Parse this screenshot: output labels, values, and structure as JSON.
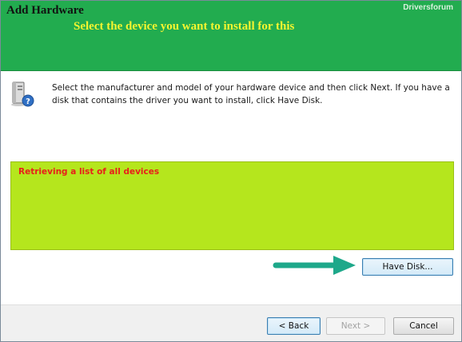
{
  "header": {
    "title": "Add Hardware",
    "subtitle": "Select the device you want to install for this",
    "watermark": "Driversforum"
  },
  "main": {
    "instructions": "Select the manufacturer and model of your hardware device and then click Next. If you have a disk that contains the driver you want to install, click Have Disk.",
    "device_list": {
      "status_text": "Retrieving a list of all devices"
    },
    "have_disk_label": "Have Disk..."
  },
  "footer": {
    "back_label": "< Back",
    "next_label": "Next >",
    "cancel_label": "Cancel"
  },
  "icons": {
    "device": "computer-tower-question-icon",
    "annotation": "arrow-right-icon"
  },
  "colors": {
    "header_bg": "#22ac4f",
    "subtitle": "#f5f530",
    "list_bg": "#b5e61d",
    "status_text": "#e8201a",
    "arrow": "#1ea88a"
  }
}
